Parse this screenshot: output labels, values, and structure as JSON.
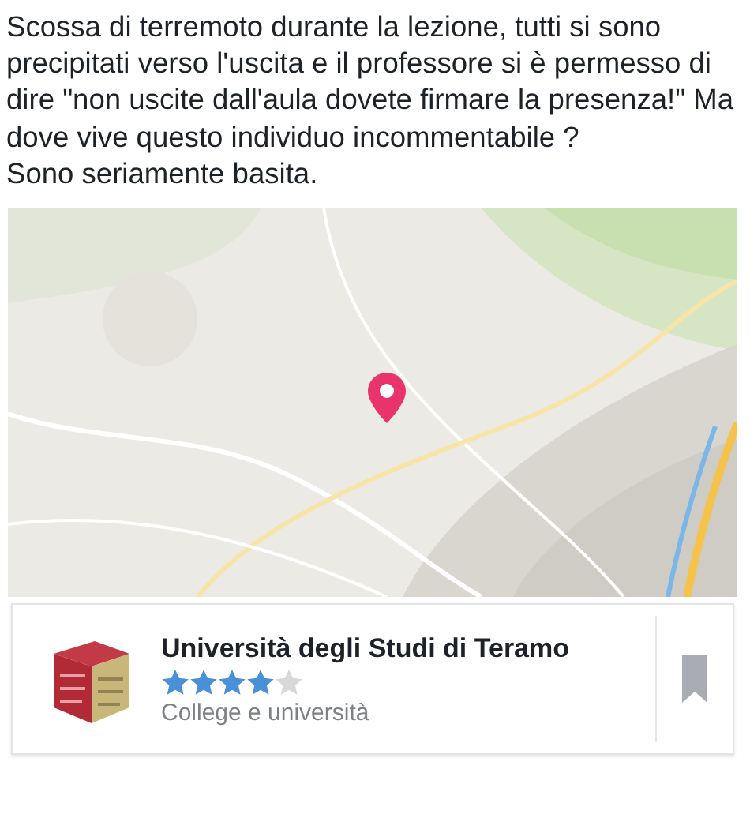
{
  "post": {
    "paragraphs": [
      "Scossa di terremoto durante la lezione, tutti si sono precipitati verso l'uscita e il professore si è permesso di dire \"non uscite dall'aula dovete firmare la presenza!\" Ma dove vive questo individuo incommentabile ?",
      "Sono seriamente basita."
    ]
  },
  "place": {
    "name": "Università degli Studi di Teramo",
    "stars": 4,
    "category": "College e università"
  }
}
